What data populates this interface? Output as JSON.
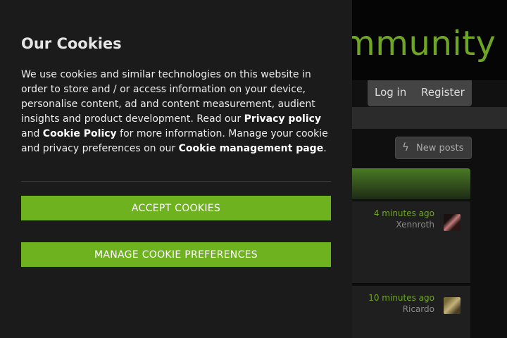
{
  "site": {
    "logo_fragment": "mmunity",
    "nav": {
      "login_label": "Log in",
      "register_label": "Register"
    },
    "new_posts_label": "New posts",
    "threads": [
      {
        "time": "4 minutes ago",
        "user": "Xennroth"
      },
      {
        "time": "10 minutes ago",
        "user": "Ricardo"
      }
    ]
  },
  "cookie_modal": {
    "title": "Our Cookies",
    "body_part1": "We use cookies and similar technologies on this website in order to store and / or access information on your device, personalise content, ad and content measurement, audient insights and product development. Read our ",
    "privacy_link": "Privacy policy",
    "body_part2": " and ",
    "cookie_policy_link": "Cookie Policy",
    "body_part3": " for more information. Manage your cookie and privacy preferences on our ",
    "cookie_management_link": "Cookie management page",
    "body_part4": ".",
    "accept_label": "ACCEPT COOKIES",
    "manage_label": "MANAGE COOKIE PREFERENCES"
  },
  "colors": {
    "accent": "#6fb21f",
    "logo": "#6fa525",
    "panel": "#1b1b1b"
  }
}
